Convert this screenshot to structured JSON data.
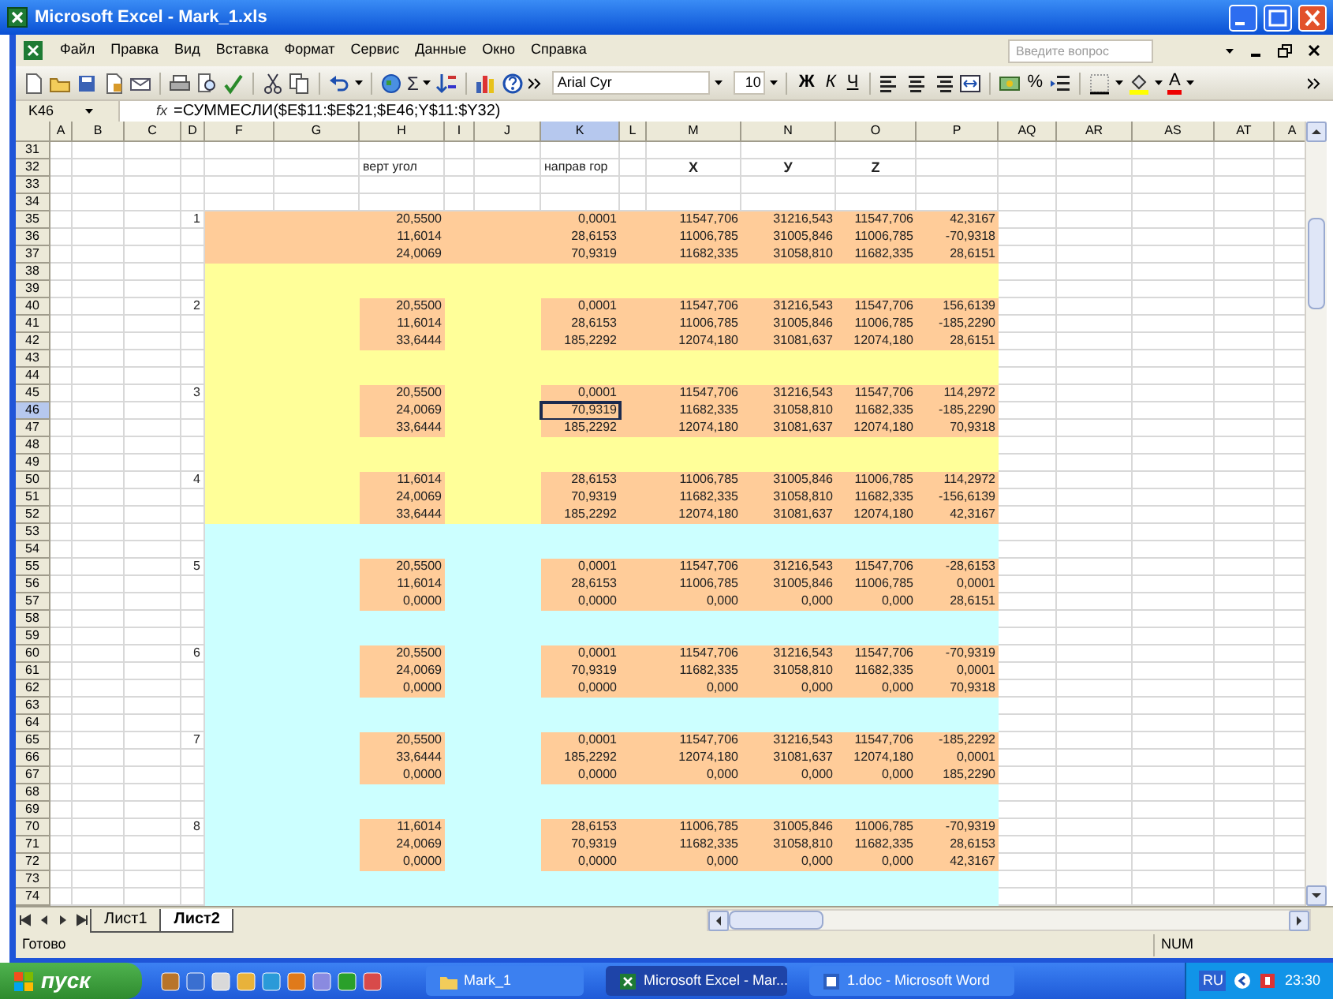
{
  "window": {
    "title": "Microsoft Excel - Mark_1.xls"
  },
  "menu": [
    "Файл",
    "Правка",
    "Вид",
    "Вставка",
    "Формат",
    "Сервис",
    "Данные",
    "Окно",
    "Справка"
  ],
  "help_search": {
    "placeholder": "Введите вопрос"
  },
  "toolbar": {
    "autosum": "Σ",
    "font": "Arial Cyr",
    "size": "10",
    "bold": "Ж",
    "italic": "К",
    "underline": "Ч",
    "percent": "%",
    "font_color": "A"
  },
  "formula_bar": {
    "name_box": "K46",
    "fx": "fx",
    "formula": "=СУММЕСЛИ($E$11:$E$21;$E46;Y$11:$Y32)"
  },
  "columns": [
    {
      "label": "A",
      "selected": false
    },
    {
      "label": "B",
      "selected": false
    },
    {
      "label": "C",
      "selected": false
    },
    {
      "label": "D",
      "selected": false
    },
    {
      "label": "F",
      "selected": false
    },
    {
      "label": "G",
      "selected": false
    },
    {
      "label": "H",
      "selected": false
    },
    {
      "label": "I",
      "selected": false
    },
    {
      "label": "J",
      "selected": false
    },
    {
      "label": "K",
      "selected": true
    },
    {
      "label": "L",
      "selected": false
    },
    {
      "label": "M",
      "selected": false
    },
    {
      "label": "N",
      "selected": false
    },
    {
      "label": "O",
      "selected": false
    },
    {
      "label": "P",
      "selected": false
    },
    {
      "label": "AQ",
      "selected": false
    },
    {
      "label": "AR",
      "selected": false
    },
    {
      "label": "AS",
      "selected": false
    },
    {
      "label": "AT",
      "selected": false
    },
    {
      "label": "A",
      "selected": false
    }
  ],
  "rows": [
    {
      "number": "31",
      "selected": false,
      "highlighted": false,
      "kind": "blank"
    },
    {
      "number": "32",
      "selected": false,
      "highlighted": false,
      "kind": "header",
      "headers": [
        "верт угол",
        "направ гор",
        "X",
        "У",
        "Z"
      ]
    },
    {
      "number": "33",
      "selected": false,
      "highlighted": false,
      "kind": "blank"
    },
    {
      "number": "34",
      "selected": false,
      "highlighted": false,
      "kind": "blank"
    },
    {
      "number": "35",
      "selected": false,
      "highlighted": false,
      "kind": "data",
      "color": "#ffcc99",
      "group": "1",
      "values": [
        "20,5500",
        "0,0001",
        "11547,706",
        "31216,543",
        "11547,706",
        "42,3167"
      ]
    },
    {
      "number": "36",
      "selected": false,
      "highlighted": false,
      "kind": "data",
      "color": "#ffcc99",
      "values": [
        "11,6014",
        "28,6153",
        "11006,785",
        "31005,846",
        "11006,785",
        "-70,9318"
      ]
    },
    {
      "number": "37",
      "selected": false,
      "highlighted": false,
      "kind": "data",
      "color": "#ffcc99",
      "values": [
        "24,0069",
        "70,9319",
        "11682,335",
        "31058,810",
        "11682,335",
        "28,6151"
      ]
    },
    {
      "number": "38",
      "selected": false,
      "highlighted": false,
      "kind": "blank",
      "color": "#ffff99"
    },
    {
      "number": "39",
      "selected": false,
      "highlighted": false,
      "kind": "blank",
      "color": "#ffff99"
    },
    {
      "number": "40",
      "selected": false,
      "highlighted": true,
      "kind": "data",
      "color": "#ffff99",
      "group": "2",
      "values": [
        "20,5500",
        "0,0001",
        "11547,706",
        "31216,543",
        "11547,706",
        "156,6139"
      ]
    },
    {
      "number": "41",
      "selected": false,
      "highlighted": true,
      "kind": "data",
      "color": "#ffff99",
      "values": [
        "11,6014",
        "28,6153",
        "11006,785",
        "31005,846",
        "11006,785",
        "-185,2290"
      ]
    },
    {
      "number": "42",
      "selected": false,
      "highlighted": true,
      "kind": "data",
      "color": "#ffff99",
      "values": [
        "33,6444",
        "185,2292",
        "12074,180",
        "31081,637",
        "12074,180",
        "28,6151"
      ]
    },
    {
      "number": "43",
      "selected": false,
      "highlighted": false,
      "kind": "blank",
      "color": "#ffff99"
    },
    {
      "number": "44",
      "selected": false,
      "highlighted": false,
      "kind": "blank",
      "color": "#ffff99"
    },
    {
      "number": "45",
      "selected": false,
      "highlighted": true,
      "kind": "data",
      "color": "#ffff99",
      "group": "3",
      "values": [
        "20,5500",
        "0,0001",
        "11547,706",
        "31216,543",
        "11547,706",
        "114,2972"
      ]
    },
    {
      "number": "46",
      "selected": true,
      "highlighted": true,
      "kind": "data",
      "color": "#ffff99",
      "values": [
        "24,0069",
        "70,9319",
        "11682,335",
        "31058,810",
        "11682,335",
        "-185,2290"
      ]
    },
    {
      "number": "47",
      "selected": false,
      "highlighted": true,
      "kind": "data",
      "color": "#ffff99",
      "values": [
        "33,6444",
        "185,2292",
        "12074,180",
        "31081,637",
        "12074,180",
        "70,9318"
      ]
    },
    {
      "number": "48",
      "selected": false,
      "highlighted": false,
      "kind": "blank",
      "color": "#ffff99"
    },
    {
      "number": "49",
      "selected": false,
      "highlighted": false,
      "kind": "blank",
      "color": "#ffff99"
    },
    {
      "number": "50",
      "selected": false,
      "highlighted": true,
      "kind": "data",
      "color": "#ffff99",
      "group": "4",
      "values": [
        "11,6014",
        "28,6153",
        "11006,785",
        "31005,846",
        "11006,785",
        "114,2972"
      ]
    },
    {
      "number": "51",
      "selected": false,
      "highlighted": true,
      "kind": "data",
      "color": "#ffff99",
      "values": [
        "24,0069",
        "70,9319",
        "11682,335",
        "31058,810",
        "11682,335",
        "-156,6139"
      ]
    },
    {
      "number": "52",
      "selected": false,
      "highlighted": true,
      "kind": "data",
      "color": "#ffff99",
      "values": [
        "33,6444",
        "185,2292",
        "12074,180",
        "31081,637",
        "12074,180",
        "42,3167"
      ]
    },
    {
      "number": "53",
      "selected": false,
      "highlighted": false,
      "kind": "blank",
      "color": "#ccffff"
    },
    {
      "number": "54",
      "selected": false,
      "highlighted": false,
      "kind": "blank",
      "color": "#ccffff"
    },
    {
      "number": "55",
      "selected": false,
      "highlighted": true,
      "kind": "data",
      "color": "#ccffff",
      "group": "5",
      "values": [
        "20,5500",
        "0,0001",
        "11547,706",
        "31216,543",
        "11547,706",
        "-28,6153"
      ]
    },
    {
      "number": "56",
      "selected": false,
      "highlighted": true,
      "kind": "data",
      "color": "#ccffff",
      "values": [
        "11,6014",
        "28,6153",
        "11006,785",
        "31005,846",
        "11006,785",
        "0,0001"
      ]
    },
    {
      "number": "57",
      "selected": false,
      "highlighted": true,
      "kind": "data",
      "color": "#ccffff",
      "values": [
        "0,0000",
        "0,0000",
        "0,000",
        "0,000",
        "0,000",
        "28,6151"
      ]
    },
    {
      "number": "58",
      "selected": false,
      "highlighted": false,
      "kind": "blank",
      "color": "#ccffff"
    },
    {
      "number": "59",
      "selected": false,
      "highlighted": false,
      "kind": "blank",
      "color": "#ccffff"
    },
    {
      "number": "60",
      "selected": false,
      "highlighted": true,
      "kind": "data",
      "color": "#ccffff",
      "group": "6",
      "values": [
        "20,5500",
        "0,0001",
        "11547,706",
        "31216,543",
        "11547,706",
        "-70,9319"
      ]
    },
    {
      "number": "61",
      "selected": false,
      "highlighted": true,
      "kind": "data",
      "color": "#ccffff",
      "values": [
        "24,0069",
        "70,9319",
        "11682,335",
        "31058,810",
        "11682,335",
        "0,0001"
      ]
    },
    {
      "number": "62",
      "selected": false,
      "highlighted": true,
      "kind": "data",
      "color": "#ccffff",
      "values": [
        "0,0000",
        "0,0000",
        "0,000",
        "0,000",
        "0,000",
        "70,9318"
      ]
    },
    {
      "number": "63",
      "selected": false,
      "highlighted": false,
      "kind": "blank",
      "color": "#ccffff"
    },
    {
      "number": "64",
      "selected": false,
      "highlighted": false,
      "kind": "blank",
      "color": "#ccffff"
    },
    {
      "number": "65",
      "selected": false,
      "highlighted": true,
      "kind": "data",
      "color": "#ccffff",
      "group": "7",
      "values": [
        "20,5500",
        "0,0001",
        "11547,706",
        "31216,543",
        "11547,706",
        "-185,2292"
      ]
    },
    {
      "number": "66",
      "selected": false,
      "highlighted": true,
      "kind": "data",
      "color": "#ccffff",
      "values": [
        "33,6444",
        "185,2292",
        "12074,180",
        "31081,637",
        "12074,180",
        "0,0001"
      ]
    },
    {
      "number": "67",
      "selected": false,
      "highlighted": true,
      "kind": "data",
      "color": "#ccffff",
      "values": [
        "0,0000",
        "0,0000",
        "0,000",
        "0,000",
        "0,000",
        "185,2290"
      ]
    },
    {
      "number": "68",
      "selected": false,
      "highlighted": false,
      "kind": "blank",
      "color": "#ccffff"
    },
    {
      "number": "69",
      "selected": false,
      "highlighted": false,
      "kind": "blank",
      "color": "#ccffff"
    },
    {
      "number": "70",
      "selected": false,
      "highlighted": true,
      "kind": "data",
      "color": "#ccffff",
      "group": "8",
      "values": [
        "11,6014",
        "28,6153",
        "11006,785",
        "31005,846",
        "11006,785",
        "-70,9319"
      ]
    },
    {
      "number": "71",
      "selected": false,
      "highlighted": true,
      "kind": "data",
      "color": "#ccffff",
      "values": [
        "24,0069",
        "70,9319",
        "11682,335",
        "31058,810",
        "11682,335",
        "28,6153"
      ]
    },
    {
      "number": "72",
      "selected": false,
      "highlighted": true,
      "kind": "data",
      "color": "#ccffff",
      "values": [
        "0,0000",
        "0,0000",
        "0,000",
        "0,000",
        "0,000",
        "42,3167"
      ]
    },
    {
      "number": "73",
      "selected": false,
      "highlighted": false,
      "kind": "blank",
      "color": "#ccffff"
    },
    {
      "number": "74",
      "selected": false,
      "highlighted": false,
      "kind": "blank",
      "color": "#ccffff"
    }
  ],
  "sheet_tabs": [
    {
      "label": "Лист1",
      "selected": false
    },
    {
      "label": "Лист2",
      "selected": true
    }
  ],
  "status_bar": {
    "message": "Готово",
    "num": "NUM"
  },
  "taskbar": {
    "start": "пуск",
    "tasks": [
      {
        "label": "Mark_1",
        "selected": false
      },
      {
        "label": "Microsoft Excel - Mar...",
        "selected": true
      },
      {
        "label": "1.doc - Microsoft Word",
        "selected": false
      }
    ],
    "language": "RU",
    "clock": "23:30"
  }
}
